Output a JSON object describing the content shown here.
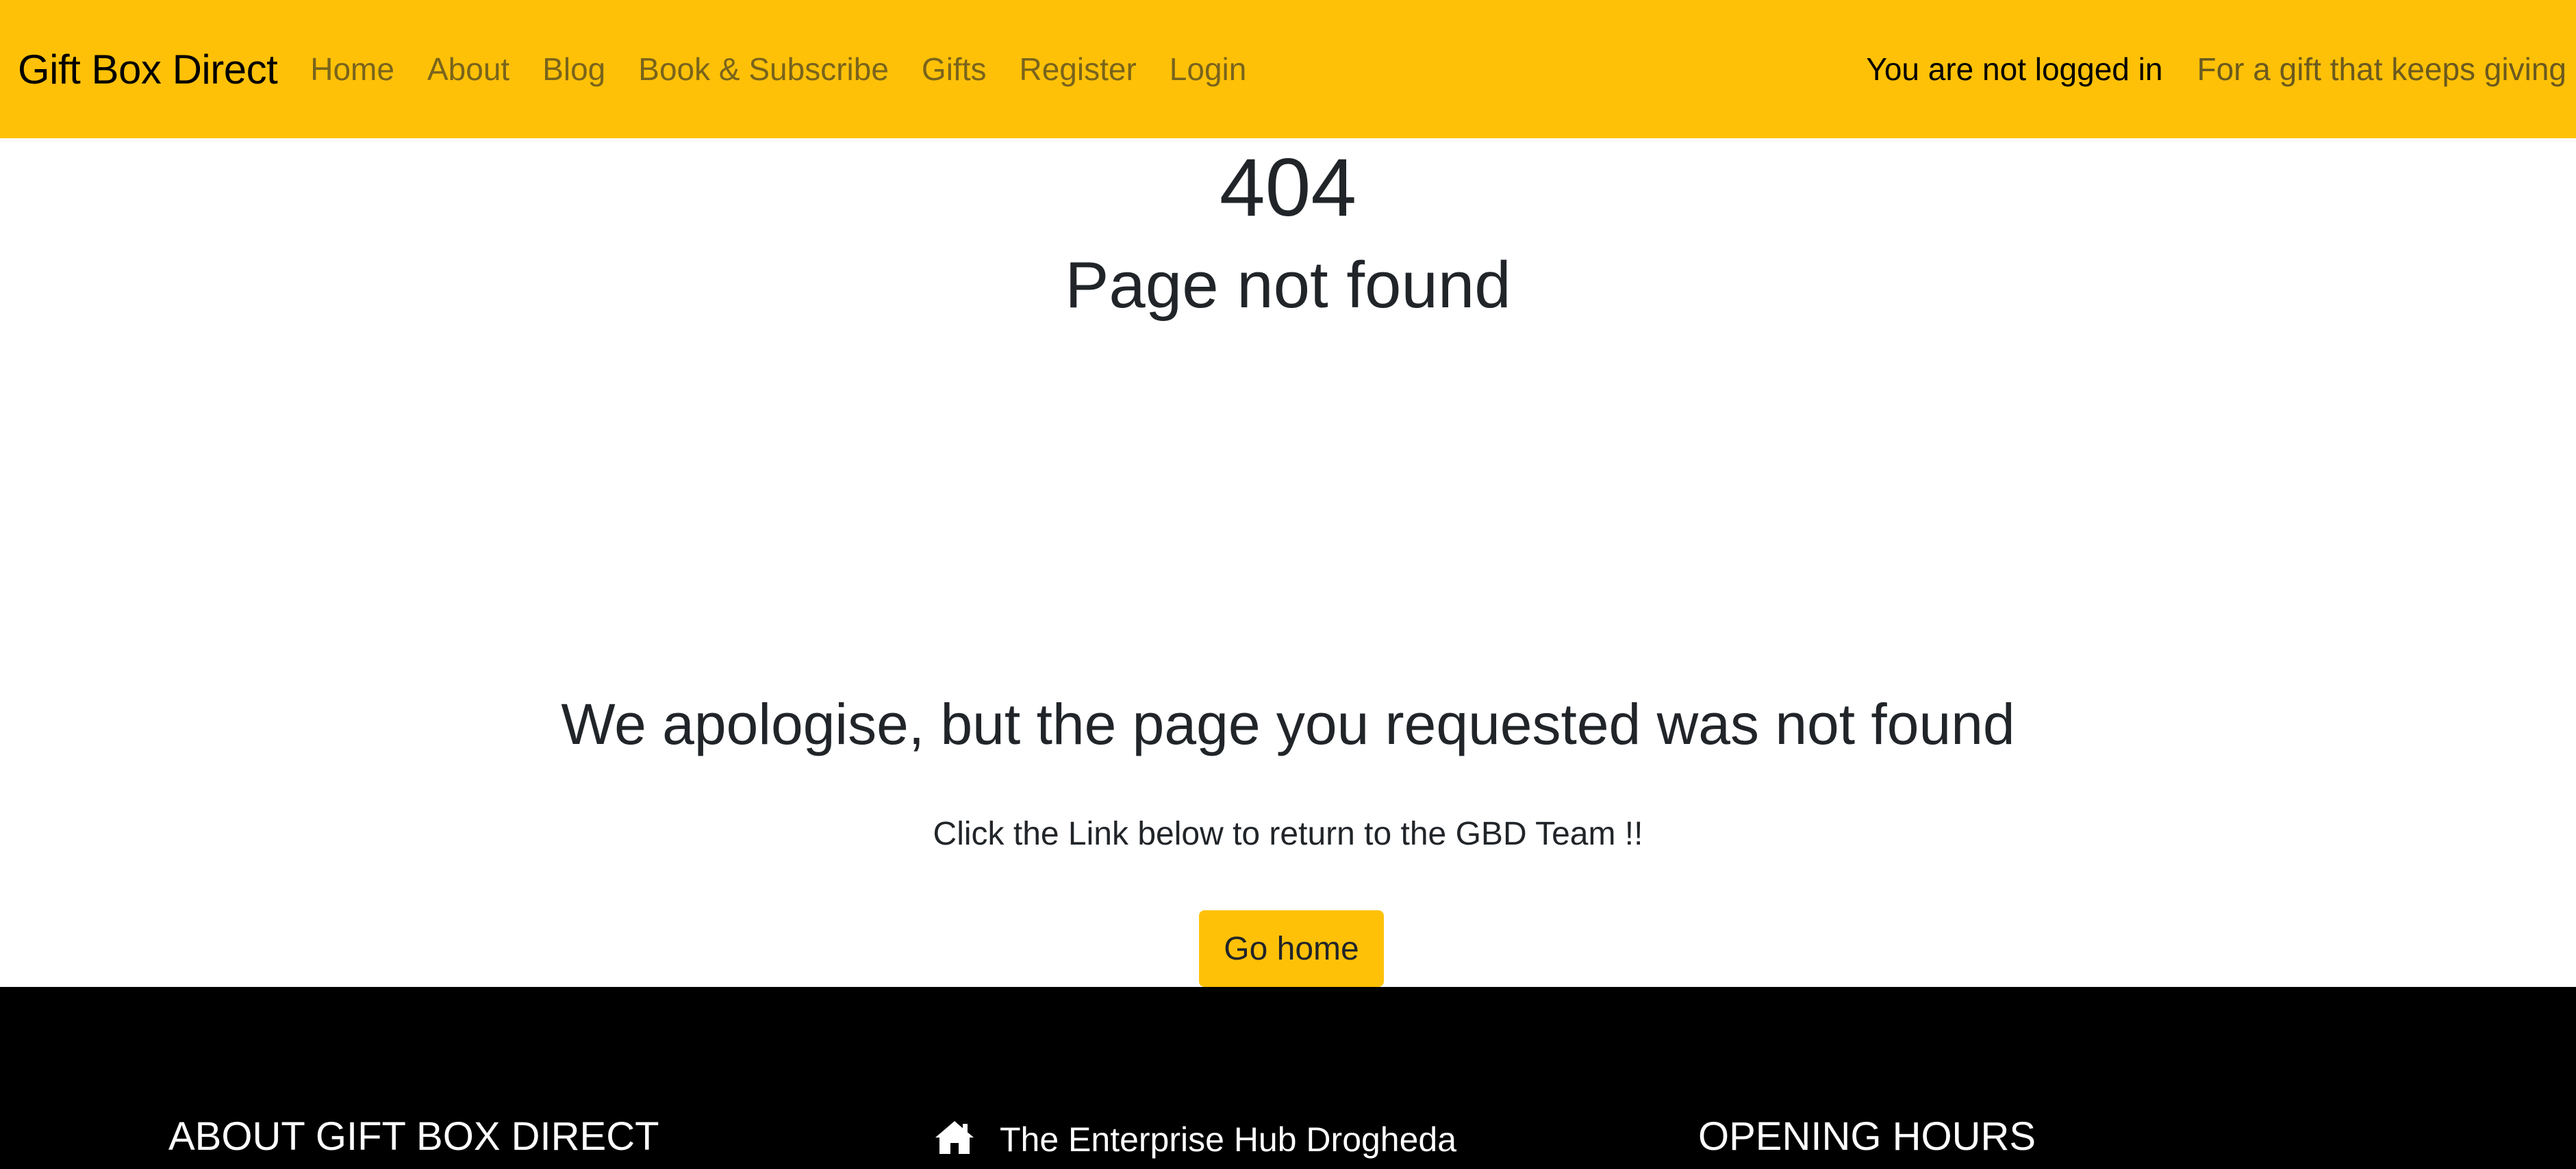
{
  "navbar": {
    "brand": "Gift Box Direct",
    "links": [
      {
        "label": "Home"
      },
      {
        "label": "About"
      },
      {
        "label": "Blog"
      },
      {
        "label": "Book & Subscribe"
      },
      {
        "label": "Gifts"
      },
      {
        "label": "Register"
      },
      {
        "label": "Login"
      }
    ],
    "login_status": "You are not logged in",
    "tagline": "For a gift that keeps giving",
    "background_color": "#ffc107"
  },
  "main": {
    "error_code": "404",
    "error_title": "Page not found",
    "apology": "We apologise, but the page you requested was not found",
    "instruction": "Click the Link below to return to the GBD Team !!",
    "home_button_label": "Go home"
  },
  "footer": {
    "about_heading": "ABOUT GIFT BOX DIRECT",
    "address_icon": "home-icon",
    "address": "The Enterprise Hub Drogheda",
    "hours_heading": "OPENING HOURS",
    "background_color": "#000000"
  }
}
